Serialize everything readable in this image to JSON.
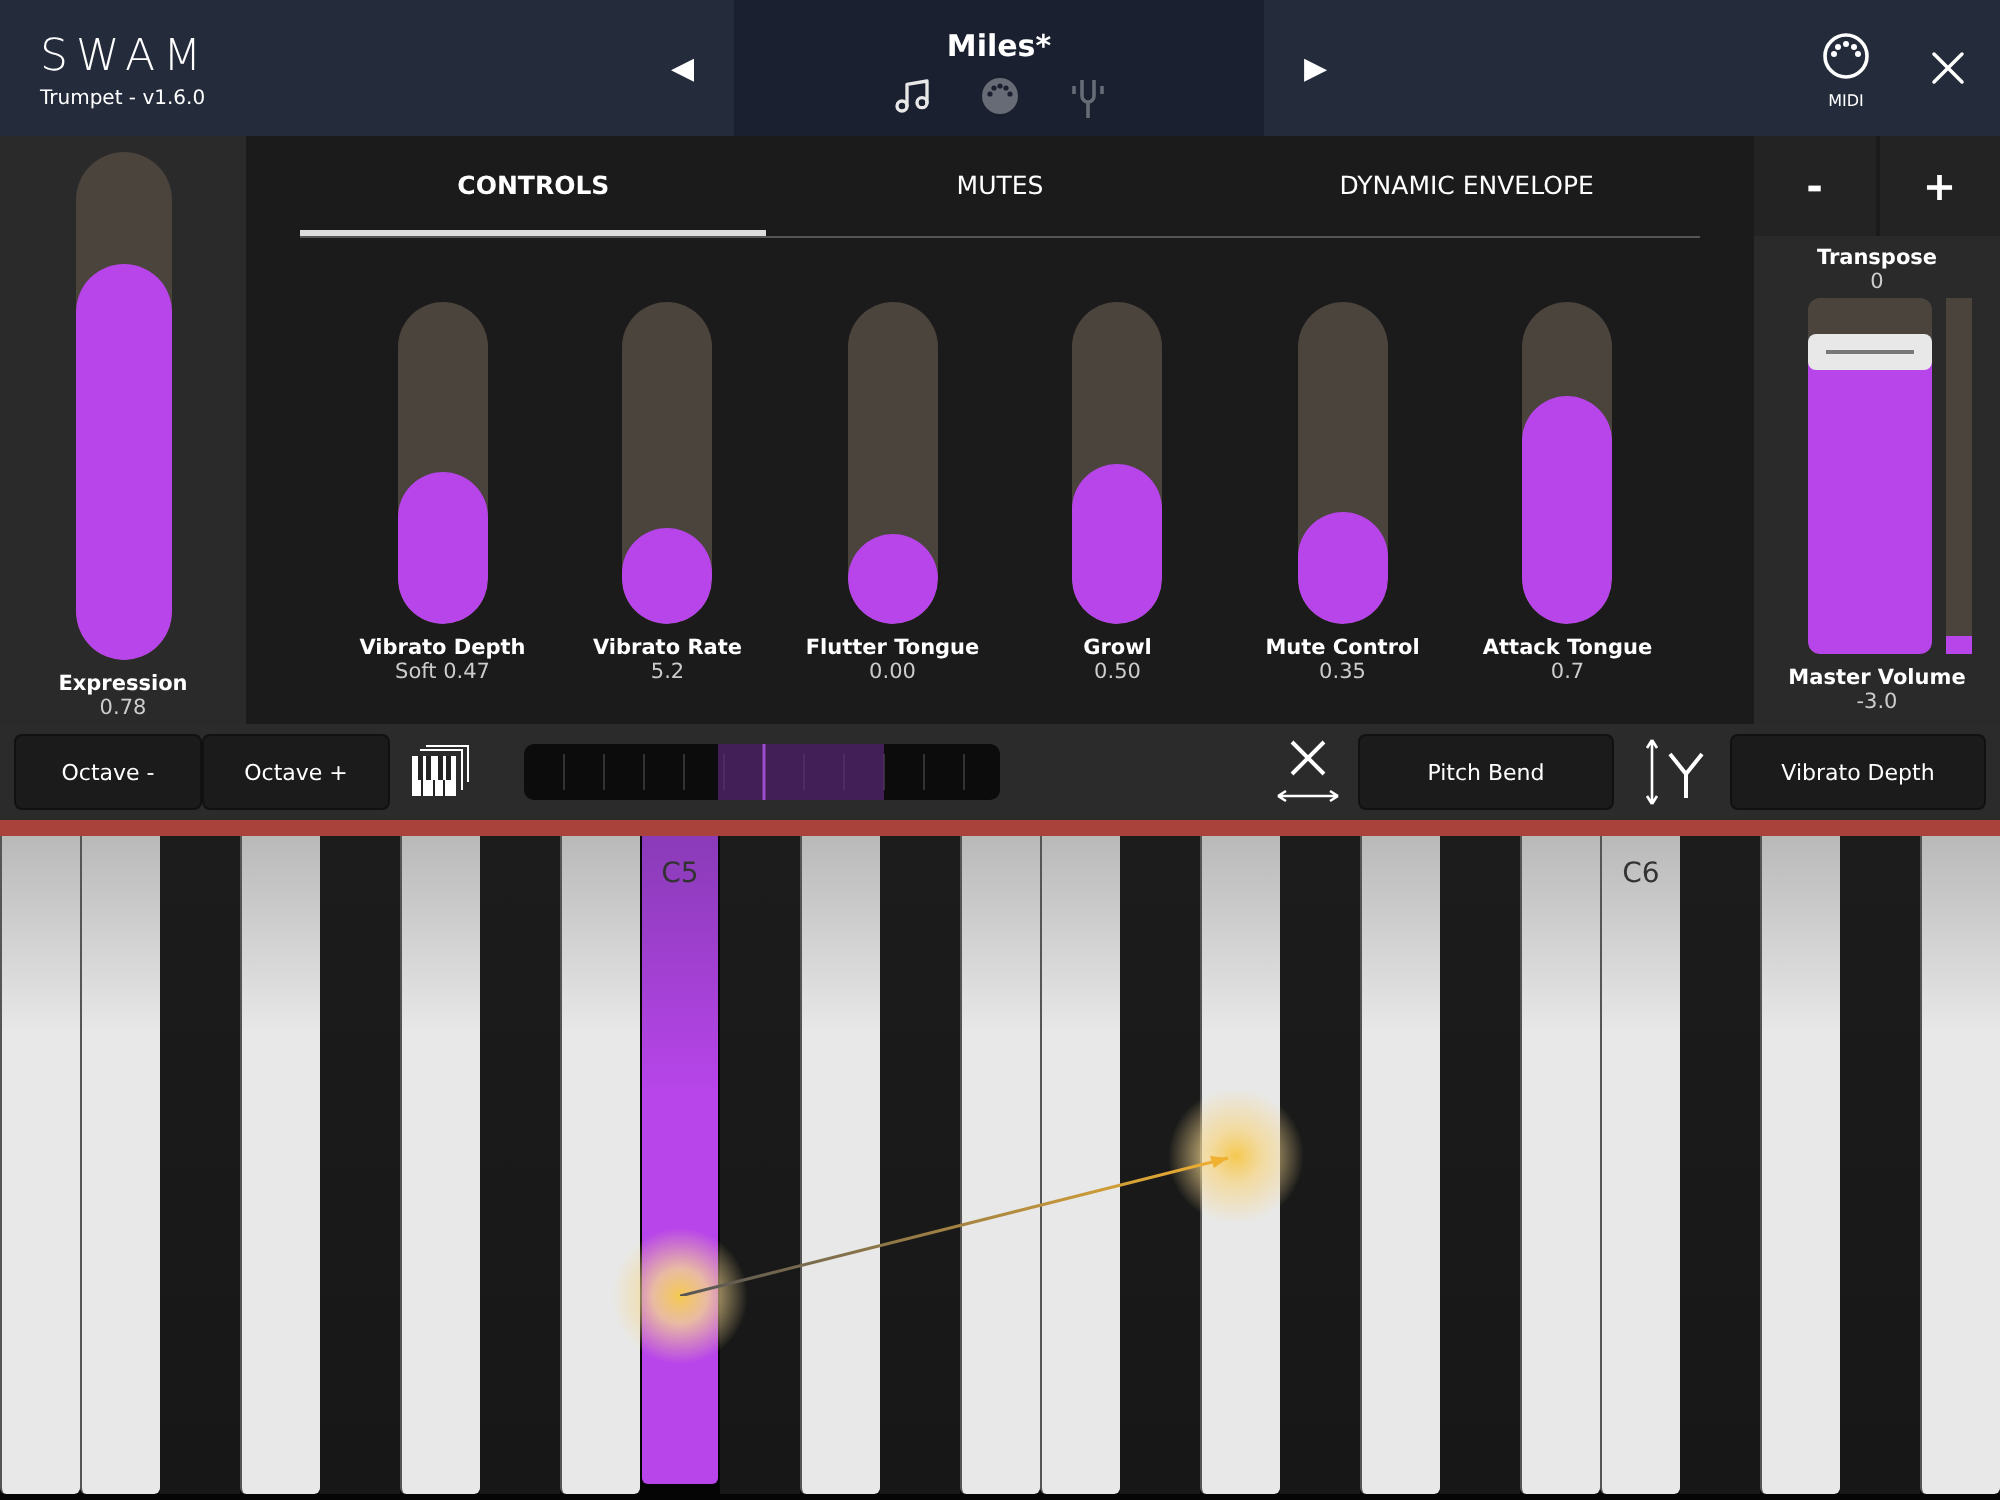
{
  "header": {
    "logo": "SWAM",
    "subtitle": "Trumpet - v1.6.0",
    "prev": "◀",
    "preset": "Miles*",
    "next": "▶",
    "views": [
      {
        "kind": "note",
        "selected": true
      },
      {
        "kind": "midi",
        "selected": false
      },
      {
        "kind": "fork",
        "selected": false
      }
    ],
    "midi_label": "MIDI"
  },
  "expression": {
    "label": "Expression",
    "reading": "0.78",
    "level": 0.78
  },
  "tabs": [
    {
      "label": "CONTROLS",
      "selected": true
    },
    {
      "label": "MUTES",
      "selected": false
    },
    {
      "label": "DYNAMIC ENVELOPE",
      "selected": false
    }
  ],
  "controls": [
    {
      "name": "Vibrato Depth",
      "reading": "Soft 0.47",
      "level": 0.47
    },
    {
      "name": "Vibrato Rate",
      "reading": "5.2",
      "level": 0.3
    },
    {
      "name": "Flutter Tongue",
      "reading": "0.00",
      "level": 0.28
    },
    {
      "name": "Growl",
      "reading": "0.50",
      "level": 0.5
    },
    {
      "name": "Mute Control",
      "reading": "0.35",
      "level": 0.35
    },
    {
      "name": "Attack Tongue",
      "reading": "0.7",
      "level": 0.71
    }
  ],
  "transpose": {
    "minus": "-",
    "plus": "+",
    "label": "Transpose",
    "reading": "0"
  },
  "master": {
    "label": "Master Volume",
    "reading": "-3.0",
    "level": 0.9,
    "meter": {
      "level": 0.05
    }
  },
  "toolbar": {
    "octave_down": "Octave -",
    "octave_up": "Octave +",
    "x_assign": "Pitch Bend",
    "y_assign": "Vibrato Depth"
  },
  "keys": [
    {
      "kind": "white",
      "selected": false
    },
    {
      "kind": "white",
      "selected": false
    },
    {
      "kind": "black",
      "selected": false
    },
    {
      "kind": "white",
      "selected": false
    },
    {
      "kind": "black",
      "selected": false
    },
    {
      "kind": "white",
      "selected": false
    },
    {
      "kind": "black",
      "selected": false
    },
    {
      "kind": "white",
      "selected": false
    },
    {
      "kind": "white",
      "selected": true,
      "label": "C5"
    },
    {
      "kind": "black",
      "selected": false
    },
    {
      "kind": "white",
      "selected": false
    },
    {
      "kind": "black",
      "selected": false
    },
    {
      "kind": "white",
      "selected": false
    },
    {
      "kind": "white",
      "selected": false
    },
    {
      "kind": "black",
      "selected": false
    },
    {
      "kind": "white",
      "selected": false
    },
    {
      "kind": "black",
      "selected": false
    },
    {
      "kind": "white",
      "selected": false
    },
    {
      "kind": "black",
      "selected": false
    },
    {
      "kind": "white",
      "selected": false
    },
    {
      "kind": "white",
      "selected": false,
      "label": "C6"
    },
    {
      "kind": "black",
      "selected": false
    },
    {
      "kind": "white",
      "selected": false
    },
    {
      "kind": "black",
      "selected": false
    },
    {
      "kind": "white",
      "selected": false
    }
  ]
}
